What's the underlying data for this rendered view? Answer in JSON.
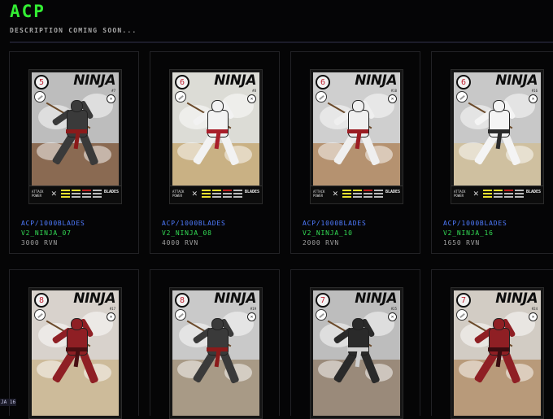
{
  "page": {
    "title": "ACP",
    "subtitle": "DESCRIPTION COMING SOON..."
  },
  "cards_row1": [
    {
      "collection": "ACP/1000BLADES",
      "name": "V2_NINJA_07",
      "price": "3000 RVN",
      "card_word": "NINJA",
      "card_number": "#7",
      "outfit": "#3a3a3a",
      "accent": "#8b1a1a",
      "sky": "#bdbdbd",
      "ground": "#8a6a52",
      "hearts": "5"
    },
    {
      "collection": "ACP/1000BLADES",
      "name": "V2_NINJA_08",
      "price": "4000 RVN",
      "card_word": "NINJA",
      "card_number": "#8",
      "outfit": "#f2f2f2",
      "accent": "#a81e2a",
      "sky": "#dcdcd6",
      "ground": "#c9b184",
      "hearts": "6"
    },
    {
      "collection": "ACP/1000BLADES",
      "name": "V2_NINJA_10",
      "price": "2000 RVN",
      "card_word": "NINJA",
      "card_number": "#10",
      "outfit": "#efefef",
      "accent": "#9a1c22",
      "sky": "#cfcfcf",
      "ground": "#b59270",
      "hearts": "6"
    },
    {
      "collection": "ACP/1000BLADES",
      "name": "V2_NINJA_16",
      "price": "1650 RVN",
      "card_word": "NINJA",
      "card_number": "#16",
      "outfit": "#f4f4f4",
      "accent": "#2a2a2a",
      "sky": "#c8c8c8",
      "ground": "#cfc0a0",
      "hearts": "6"
    }
  ],
  "cards_row2": [
    {
      "card_word": "NINJA",
      "card_number": "#17",
      "outfit": "#8f1f24",
      "accent": "#4a0f12",
      "sky": "#d8d2cc",
      "ground": "#cdbb9a",
      "hearts": "8"
    },
    {
      "card_word": "NINJA",
      "card_number": "#19",
      "outfit": "#3a3a3a",
      "accent": "#8b1a1a",
      "sky": "#c9c9c9",
      "ground": "#a89a86",
      "hearts": "8"
    },
    {
      "card_word": "NINJA",
      "card_number": "#25",
      "outfit": "#2a2a2a",
      "accent": "#cfcfcf",
      "sky": "#bdbdbd",
      "ground": "#9a8a7a",
      "hearts": "7"
    },
    {
      "card_word": "NINJA",
      "card_number": "#24",
      "outfit": "#8f1f24",
      "accent": "#3a0c10",
      "sky": "#d2ccc4",
      "ground": "#b89a7a",
      "hearts": "7"
    }
  ],
  "card_bar": {
    "label": "ATTACK POWER",
    "logo": "BLADES"
  },
  "corner_tag": "JA 16",
  "colors": {
    "title": "#33ee33",
    "collection": "#4f7bff",
    "name": "#33dd55",
    "price": "#a0a0a0",
    "background": "#050506"
  }
}
